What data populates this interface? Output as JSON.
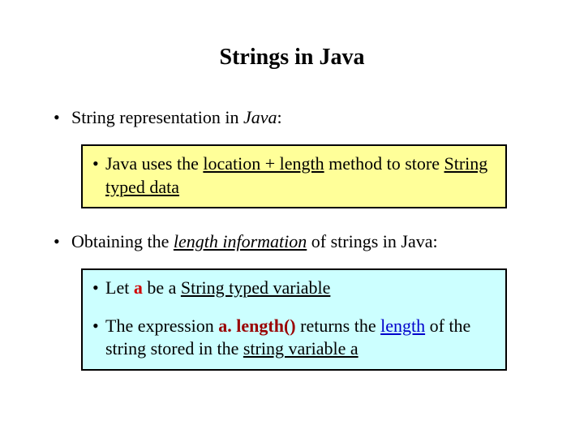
{
  "title": "Strings in Java",
  "bullet1": {
    "pre": "String representation in ",
    "java": "Java",
    "post": ":"
  },
  "box1": {
    "pre": "Java uses the ",
    "u1": "location + length",
    "mid": " method to store ",
    "u2": "String typed data"
  },
  "bullet2": {
    "pre": "Obtaining the ",
    "em": "length information",
    "post": " of strings in Java:"
  },
  "box2a": {
    "t1": "Let ",
    "a1": "a",
    "t2": " be a ",
    "u1": "String typed variable"
  },
  "box2b": {
    "t1": "The expression ",
    "call": "a. length()",
    "t2": " returns the ",
    "u1": "length",
    "t3": " of the string stored in the ",
    "u2": "string variable a"
  }
}
